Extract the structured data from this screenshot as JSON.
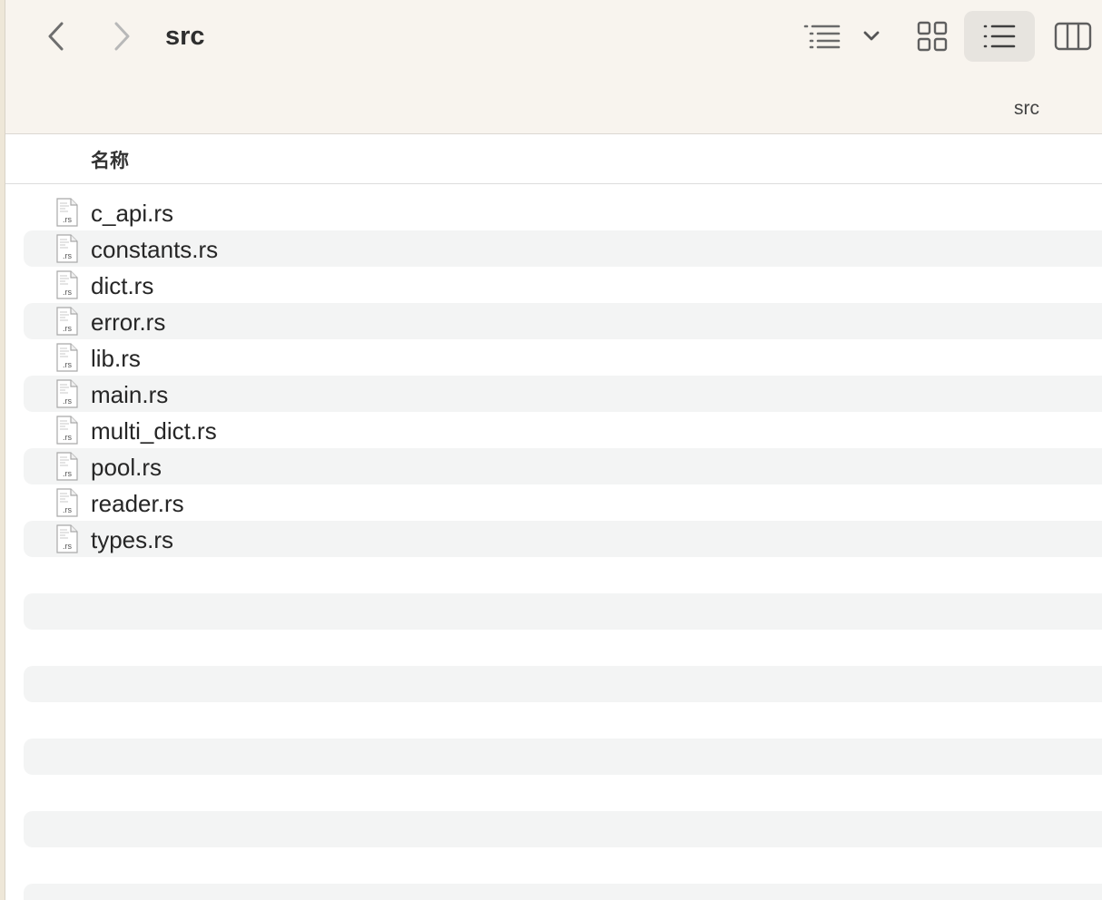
{
  "window": {
    "title": "src",
    "path_label": "src"
  },
  "toolbar": {
    "back_icon": "chevron-left-icon",
    "forward_icon": "chevron-right-icon",
    "group_icon": "group-by-list-icon",
    "group_dropdown_icon": "chevron-down-icon",
    "view_icon_mode": "grid-icon",
    "view_list_mode": "list-icon",
    "view_column_mode": "columns-icon",
    "active_view": "list"
  },
  "list": {
    "header": {
      "name": "名称"
    },
    "files": [
      {
        "name": "c_api.rs",
        "icon_label": ".rs"
      },
      {
        "name": "constants.rs",
        "icon_label": ".rs"
      },
      {
        "name": "dict.rs",
        "icon_label": ".rs"
      },
      {
        "name": "error.rs",
        "icon_label": ".rs"
      },
      {
        "name": "lib.rs",
        "icon_label": ".rs"
      },
      {
        "name": "main.rs",
        "icon_label": ".rs"
      },
      {
        "name": "multi_dict.rs",
        "icon_label": ".rs"
      },
      {
        "name": "pool.rs",
        "icon_label": ".rs"
      },
      {
        "name": "reader.rs",
        "icon_label": ".rs"
      },
      {
        "name": "types.rs",
        "icon_label": ".rs"
      }
    ]
  },
  "colors": {
    "toolbar_bg": "#f8f4ee",
    "stripe": "#f3f4f4",
    "selected_view_bg": "#e7e4df"
  }
}
